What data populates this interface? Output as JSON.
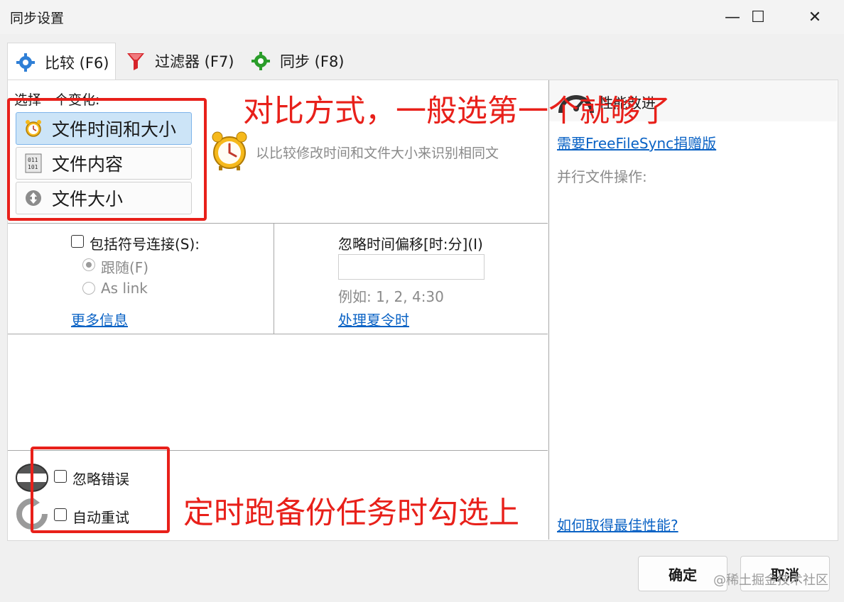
{
  "window": {
    "title": "同步设置",
    "minimize_glyph": "—",
    "maximize_glyph": "☐",
    "close_glyph": "✕"
  },
  "tabs": [
    {
      "label": "比较 (F6)",
      "icon": "gear-blue-icon",
      "selected": true
    },
    {
      "label": "过滤器 (F7)",
      "icon": "funnel-icon",
      "selected": false
    },
    {
      "label": "同步 (F8)",
      "icon": "gear-green-icon",
      "selected": false
    }
  ],
  "compare": {
    "heading": "选择一个变化:",
    "options": [
      {
        "label": "文件时间和大小",
        "icon": "alarm-clock-icon",
        "selected": true
      },
      {
        "label": "文件内容",
        "icon": "binary-file-icon",
        "selected": false
      },
      {
        "label": "文件大小",
        "icon": "size-arrow-icon",
        "selected": false
      }
    ],
    "description": "以比较修改时间和文件大小来识别相同文"
  },
  "symlinks": {
    "checkbox_label": "包括符号连接(S):",
    "follow_label": "跟随(F)",
    "aslink_label": "As link",
    "more_info_link": "更多信息"
  },
  "time_shift": {
    "label": "忽略时间偏移[时:分](I)",
    "value": "",
    "example": "例如: 1, 2, 4:30",
    "dst_link": "处理夏令时"
  },
  "errors": {
    "ignore_errors_label": "忽略错误",
    "auto_retry_label": "自动重试"
  },
  "performance": {
    "header": "性能改进",
    "donation_link": "需要FreeFileSync捐赠版",
    "parallel_label": "并行文件操作:",
    "best_perf_link": "如何取得最佳性能?"
  },
  "buttons": {
    "ok": "确定",
    "cancel": "取消"
  },
  "annotations": {
    "compare_note": "对比方式，一般选第一个就够了",
    "retry_note": "定时跑备份任务时勾选上"
  },
  "watermark": "@稀土掘金技术社区",
  "colors": {
    "annotation_red": "#e8201a",
    "link_blue": "#0b63c5",
    "selected_bg": "#cce4f7"
  }
}
